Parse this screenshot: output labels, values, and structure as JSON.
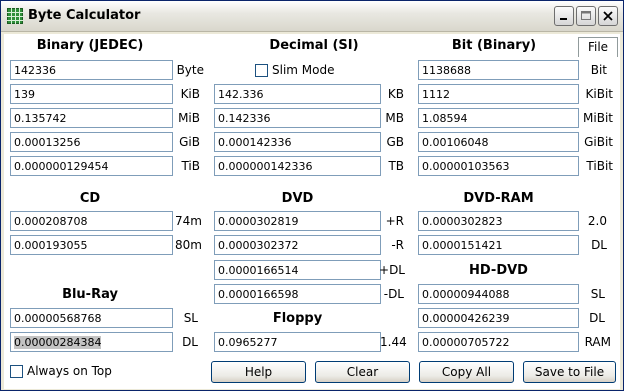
{
  "window": {
    "title": "Byte Calculator",
    "app_icon": "grid-calculator-icon"
  },
  "titlebar_buttons": {
    "minimize": "minimize-icon",
    "maximize": "maximize-icon",
    "close": "close-icon"
  },
  "tab": {
    "label": "File"
  },
  "binary": {
    "header": "Binary (JEDEC)",
    "rows": [
      {
        "value": "142336",
        "unit": "Byte"
      },
      {
        "value": "139",
        "unit": "KiB"
      },
      {
        "value": "0.135742",
        "unit": "MiB"
      },
      {
        "value": "0.00013256",
        "unit": "GiB"
      },
      {
        "value": "0.000000129454",
        "unit": "TiB"
      }
    ]
  },
  "decimal": {
    "header": "Decimal (SI)",
    "slim_mode_label": "Slim Mode",
    "rows": [
      {
        "value": "142.336",
        "unit": "KB"
      },
      {
        "value": "0.142336",
        "unit": "MB"
      },
      {
        "value": "0.000142336",
        "unit": "GB"
      },
      {
        "value": "0.000000142336",
        "unit": "TB"
      }
    ]
  },
  "bit": {
    "header": "Bit (Binary)",
    "rows": [
      {
        "value": "1138688",
        "unit": "Bit"
      },
      {
        "value": "1112",
        "unit": "KiBit"
      },
      {
        "value": "1.08594",
        "unit": "MiBit"
      },
      {
        "value": "0.00106048",
        "unit": "GiBit"
      },
      {
        "value": "0.00000103563",
        "unit": "TiBit"
      }
    ]
  },
  "cd": {
    "header": "CD",
    "rows": [
      {
        "value": "0.000208708",
        "unit": "74m"
      },
      {
        "value": "0.000193055",
        "unit": "80m"
      }
    ]
  },
  "dvd": {
    "header": "DVD",
    "rows": [
      {
        "value": "0.0000302819",
        "unit": "+R"
      },
      {
        "value": "0.0000302372",
        "unit": "-R"
      },
      {
        "value": "0.0000166514",
        "unit": "+DL"
      },
      {
        "value": "0.0000166598",
        "unit": "-DL"
      }
    ]
  },
  "dvdram": {
    "header": "DVD-RAM",
    "rows": [
      {
        "value": "0.0000302823",
        "unit": "2.0"
      },
      {
        "value": "0.0000151421",
        "unit": "DL"
      }
    ]
  },
  "hddvd": {
    "header": "HD-DVD",
    "rows": [
      {
        "value": "0.00000944088",
        "unit": "SL"
      },
      {
        "value": "0.00000426239",
        "unit": "DL"
      },
      {
        "value": "0.00000705722",
        "unit": "RAM"
      }
    ]
  },
  "bluray": {
    "header": "Blu-Ray",
    "rows": [
      {
        "value": "0.00000568768",
        "unit": "SL"
      },
      {
        "value": "0.00000284384",
        "unit": "DL"
      }
    ]
  },
  "floppy": {
    "header": "Floppy",
    "rows": [
      {
        "value": "0.0965277",
        "unit": "1.44"
      }
    ]
  },
  "always_on_top_label": "Always on Top",
  "buttons": {
    "help": "Help",
    "clear": "Clear",
    "copy_all": "Copy All",
    "save_to_file": "Save to File"
  }
}
